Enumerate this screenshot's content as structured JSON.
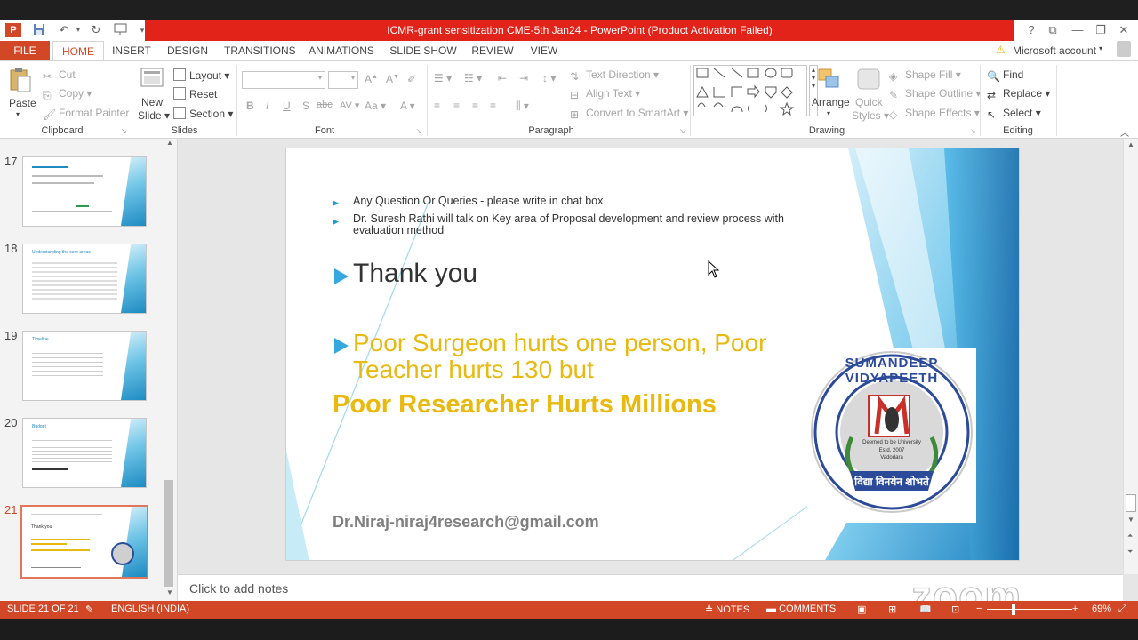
{
  "window": {
    "title": "ICMR-grant sensitization CME-5th Jan24 -  PowerPoint (Product Activation Failed)",
    "app_icon": "P",
    "controls": [
      "?",
      "⧉",
      "—",
      "❐",
      "✕"
    ]
  },
  "ribbon_tabs": [
    "FILE",
    "HOME",
    "INSERT",
    "DESIGN",
    "TRANSITIONS",
    "ANIMATIONS",
    "SLIDE SHOW",
    "REVIEW",
    "VIEW"
  ],
  "active_tab": "HOME",
  "account": "Microsoft account",
  "clipboard": {
    "paste": "Paste",
    "cut": "Cut",
    "copy": "Copy",
    "format_painter": "Format Painter",
    "label": "Clipboard"
  },
  "slides_group": {
    "new_slide_1": "New",
    "new_slide_2": "Slide",
    "layout": "Layout",
    "reset": "Reset",
    "section": "Section",
    "label": "Slides"
  },
  "font_group": {
    "label": "Font",
    "bold": "B",
    "italic": "I",
    "underline": "U",
    "shadow": "S",
    "strike": "abc",
    "spacing": "AV",
    "case": "Aa",
    "color": "A"
  },
  "paragraph_group": {
    "label": "Paragraph",
    "text_direction": "Text Direction",
    "align_text": "Align Text",
    "smartart": "Convert to SmartArt"
  },
  "drawing_group": {
    "label": "Drawing",
    "arrange": "Arrange",
    "quick_1": "Quick",
    "quick_2": "Styles",
    "shape_fill": "Shape Fill",
    "shape_outline": "Shape Outline",
    "shape_effects": "Shape Effects"
  },
  "editing_group": {
    "label": "Editing",
    "find": "Find",
    "replace": "Replace",
    "select": "Select"
  },
  "thumbnails": [
    {
      "num": "17",
      "title": ""
    },
    {
      "num": "18",
      "title": "Understanding the core areas"
    },
    {
      "num": "19",
      "title": "Timeline"
    },
    {
      "num": "20",
      "title": "Budget"
    },
    {
      "num": "21",
      "title": "Thank you"
    }
  ],
  "slide": {
    "bullets": [
      "Any Question Or Queries - please write in chat box",
      "Dr. Suresh Rathi will talk on Key area of Proposal development and review process with evaluation method"
    ],
    "thank_you": "Thank you",
    "quote_line1": "Poor Surgeon hurts one person, Poor",
    "quote_line2": "Teacher hurts 130 but",
    "quote_line3": "Poor Researcher Hurts Millions",
    "email": "Dr.Niraj-niraj4research@gmail.com",
    "logo_top": "SUMANDEEP VIDYAPEETH",
    "logo_deemed": "Deemed to be University",
    "logo_estd": "Estd. 2007",
    "logo_city": "Vadodara",
    "logo_motto": "विद्या विनयेन शोभते",
    "accent_color": "#e8b90e",
    "blue_color": "#1e9bd7"
  },
  "notes_placeholder": "Click to add notes",
  "status": {
    "slide_of": "SLIDE 21 OF 21",
    "language": "ENGLISH (INDIA)",
    "notes": "NOTES",
    "comments": "COMMENTS",
    "zoom": "69%"
  },
  "watermark": "zoom"
}
